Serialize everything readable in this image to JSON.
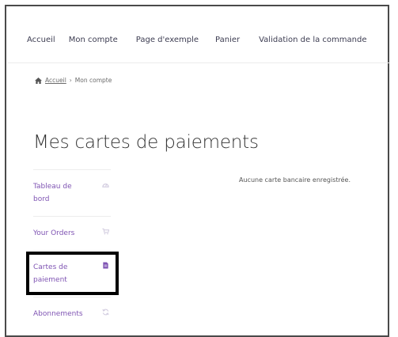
{
  "topnav": {
    "items": [
      "Accueil",
      "Mon compte",
      "Page d'exemple",
      "Panier",
      "Validation de la commande"
    ]
  },
  "breadcrumb": {
    "home": "Accueil",
    "separator": "›",
    "current": "Mon compte"
  },
  "page": {
    "title": "Mes cartes de paiements"
  },
  "sidebar": {
    "items": [
      {
        "label": "Tableau de bord",
        "icon": "dashboard-icon"
      },
      {
        "label": "Your Orders",
        "icon": "cart-icon"
      },
      {
        "label": "Cartes de paiement",
        "icon": "document-icon",
        "active": true
      },
      {
        "label": "Abonnements",
        "icon": "refresh-icon"
      }
    ]
  },
  "main": {
    "empty_message": "Aucune carte bancaire enregistrée."
  },
  "colors": {
    "accent": "#7f54b3",
    "icon_muted": "#d3cde0"
  }
}
